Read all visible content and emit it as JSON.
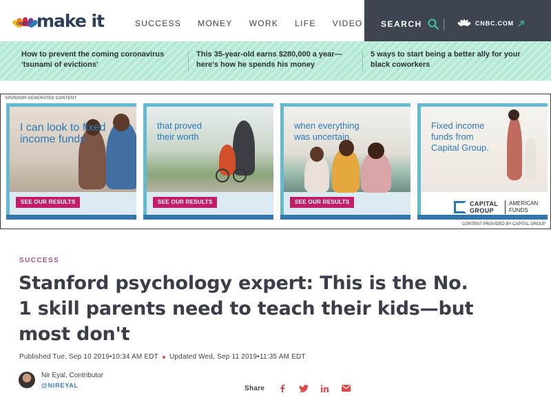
{
  "header": {
    "logo_text": "make it",
    "logo_sub": "CNBC",
    "nav": [
      "SUCCESS",
      "MONEY",
      "WORK",
      "LIFE",
      "VIDEO"
    ],
    "search_label": "SEARCH",
    "cnbc_link": "CNBC.COM",
    "colors": {
      "dark_bar": "#3e4551",
      "accent_teal": "#3ec5a4"
    }
  },
  "trending": [
    "How to prevent the coming coronavirus 'tsunami of evictions'",
    "This 35-year-old earns $280,000 a year—here's how he spends his money",
    "5 ways to start being a better ally for your black coworkers"
  ],
  "ad": {
    "sponsor_label": "SPONSOR GENERATED CONTENT",
    "provided_label": "CONTENT PROVIDED BY CAPITAL GROUP",
    "panels": [
      {
        "caption": "I can look to fixed income funds",
        "cta": "SEE OUR RESULTS"
      },
      {
        "caption": "that proved their worth",
        "cta": "SEE OUR RESULTS"
      },
      {
        "caption": "when everything was uncertain.",
        "cta": "SEE OUR RESULTS"
      },
      {
        "caption": "Fixed income funds from Capital Group.",
        "brand_1": "CAPITAL GROUP",
        "brand_2": "AMERICAN FUNDS"
      }
    ]
  },
  "article": {
    "category": "SUCCESS",
    "headline": "Stanford psychology expert: This is the No. 1 skill parents need to teach their kids—but most don't",
    "published": "Published Tue, Sep 10 2019•10:34 AM EDT",
    "updated": "Updated Wed, Sep 11 2019•11:35 AM EDT",
    "author_name": "Nir Eyal, Contributor",
    "author_handle": "@NIREYAL",
    "share_label": "Share"
  }
}
